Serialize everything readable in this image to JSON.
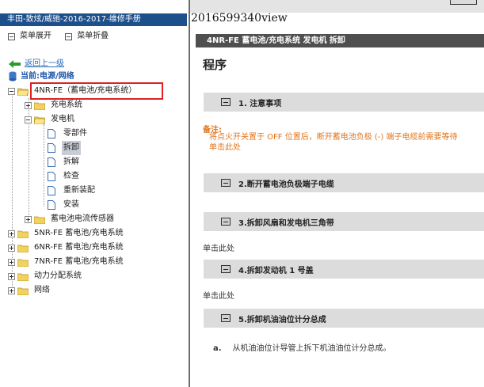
{
  "left": {
    "title": "丰田-致炫/威驰-2016-2017-维修手册",
    "toolbar": {
      "expand": "菜单展开",
      "collapse": "菜单折叠"
    },
    "back": "返回上一级",
    "current": "当前:电源/网络",
    "tree": {
      "root": "4NR-FE（蓄电池/充电系统）",
      "charging": "充电系统",
      "generator": "发电机",
      "gen_children": [
        "零部件",
        "拆卸",
        "拆解",
        "检查",
        "重新装配",
        "安装"
      ],
      "sensor": "蓄电池电流传感器",
      "siblings": [
        "5NR-FE 蓄电池/充电系统",
        "6NR-FE 蓄电池/充电系统",
        "7NR-FE 蓄电池/充电系统",
        "动力分配系统",
        "网络"
      ]
    }
  },
  "right": {
    "view_id": "2016599340view",
    "header": "4NR-FE 蓄电池/充电系统 发电机 拆卸",
    "procedure": "程序",
    "steps": [
      "1. 注意事项",
      "2.断开蓄电池负极端子电缆",
      "3.拆卸风扇和发电机三角带",
      "4.拆卸发动机 1 号盖",
      "5.拆卸机油油位计分总成"
    ],
    "note_title": "备注:",
    "note_line1": "将点火开关置于 OFF 位置后，断开蓄电池负极 (-) 端子电缆前需要等待",
    "note_line2": "单击此处",
    "click_here_1": "单击此处",
    "click_here_2": "单击此处",
    "sub_label": "a.",
    "sub_text": "从机油油位计导管上拆下机油油位计分总成。"
  },
  "colors": {
    "title_bar": "#1d4f8b",
    "note": "#e0751c",
    "highlight": "#e02020"
  }
}
